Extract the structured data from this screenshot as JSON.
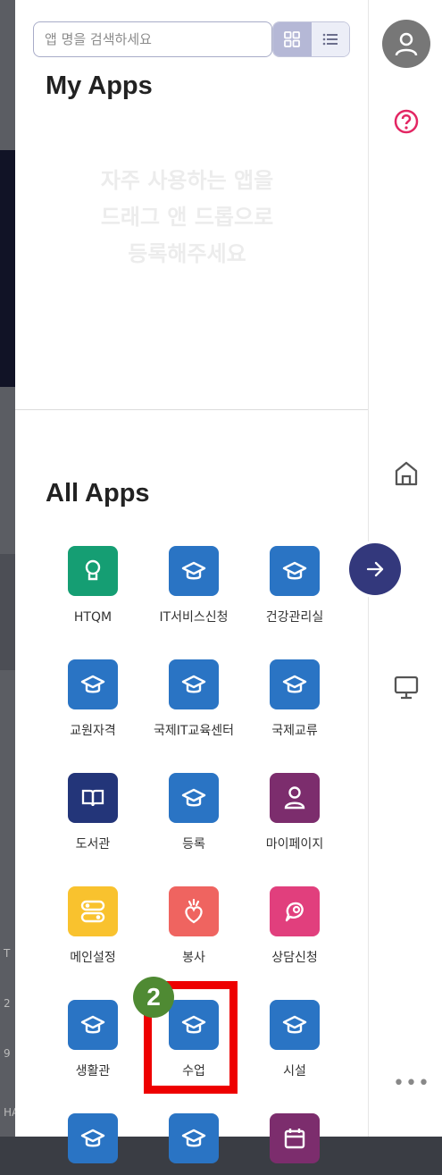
{
  "search": {
    "placeholder": "앱 명을 검색하세요"
  },
  "my_apps": {
    "title": "My Apps",
    "empty_message": "자주 사용하는 앱을\n드래그 앤 드롭으로\n등록해주세요"
  },
  "all_apps": {
    "title": "All Apps",
    "apps": [
      {
        "label": "HTQM",
        "color": "#159e73",
        "icon": "bulb-icon"
      },
      {
        "label": "IT서비스신청",
        "color": "#2a74c4",
        "icon": "graduation-cap-icon"
      },
      {
        "label": "건강관리실",
        "color": "#2a74c4",
        "icon": "graduation-cap-icon"
      },
      {
        "label": "교원자격",
        "color": "#2a74c4",
        "icon": "graduation-cap-icon"
      },
      {
        "label": "국제IT교육센터",
        "color": "#2a74c4",
        "icon": "graduation-cap-icon"
      },
      {
        "label": "국제교류",
        "color": "#2a74c4",
        "icon": "graduation-cap-icon"
      },
      {
        "label": "도서관",
        "color": "#233579",
        "icon": "book-icon"
      },
      {
        "label": "등록",
        "color": "#2a74c4",
        "icon": "graduation-cap-icon"
      },
      {
        "label": "마이페이지",
        "color": "#7c2d6d",
        "icon": "person-icon"
      },
      {
        "label": "메인설정",
        "color": "#f9c22e",
        "icon": "settings-toggle-icon"
      },
      {
        "label": "봉사",
        "color": "#ef6460",
        "icon": "heart-hand-icon"
      },
      {
        "label": "상담신청",
        "color": "#e13f7d",
        "icon": "chat-icon"
      },
      {
        "label": "생활관",
        "color": "#2a74c4",
        "icon": "graduation-cap-icon"
      },
      {
        "label": "수업",
        "color": "#2a74c4",
        "icon": "graduation-cap-icon"
      },
      {
        "label": "시설",
        "color": "#2a74c4",
        "icon": "graduation-cap-icon"
      },
      {
        "label": "",
        "color": "#2a74c4",
        "icon": "graduation-cap-icon"
      },
      {
        "label": "",
        "color": "#2a74c4",
        "icon": "graduation-cap-icon"
      },
      {
        "label": "",
        "color": "#7c2d6d",
        "icon": "calendar-icon"
      }
    ]
  },
  "annotation": {
    "badge_number": "2",
    "badge_color": "#4f8a33",
    "highlight_color": "#ee0000"
  },
  "background_text": [
    "T",
    "2",
    "9",
    "HA"
  ]
}
